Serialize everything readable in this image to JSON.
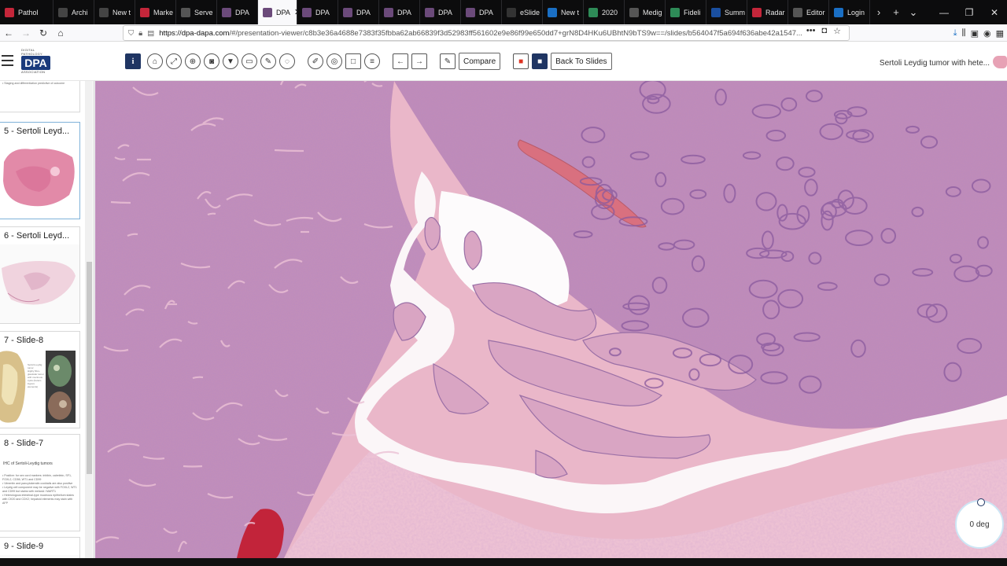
{
  "browser": {
    "tabs": [
      {
        "label": "Pathol",
        "icon": "pathology-icon",
        "color": "#c4263a"
      },
      {
        "label": "Archi",
        "icon": "archive-icon",
        "color": "#444"
      },
      {
        "label": "New t",
        "icon": "new-tab-icon",
        "color": "#444"
      },
      {
        "label": "Marke",
        "icon": "google-icon",
        "color": "#c4263a"
      },
      {
        "label": "Serve",
        "icon": "gear-icon",
        "color": "#555"
      },
      {
        "label": "DPA",
        "icon": "dpa-icon",
        "color": "#6b4a7a"
      },
      {
        "label": "DPA",
        "icon": "dpa-icon",
        "color": "#6b4a7a",
        "active": true
      },
      {
        "label": "DPA",
        "icon": "dpa-icon",
        "color": "#6b4a7a"
      },
      {
        "label": "DPA",
        "icon": "dpa-icon",
        "color": "#6b4a7a"
      },
      {
        "label": "DPA",
        "icon": "dpa-icon",
        "color": "#6b4a7a"
      },
      {
        "label": "DPA",
        "icon": "dpa-icon",
        "color": "#6b4a7a"
      },
      {
        "label": "DPA",
        "icon": "dpa-icon",
        "color": "#6b4a7a"
      },
      {
        "label": "eSlide",
        "icon": "eslide-icon",
        "color": "#333"
      },
      {
        "label": "New t",
        "icon": "search-icon",
        "color": "#1a6fc4"
      },
      {
        "label": "2020",
        "icon": "sheet-icon",
        "color": "#2e8b57"
      },
      {
        "label": "Medig",
        "icon": "medig-icon",
        "color": "#555"
      },
      {
        "label": "Fideli",
        "icon": "fidelity-icon",
        "color": "#2e8b57"
      },
      {
        "label": "Summ",
        "icon": "p-icon",
        "color": "#1a4fa0"
      },
      {
        "label": "Radar",
        "icon": "google-icon",
        "color": "#c4263a"
      },
      {
        "label": "Editor",
        "icon": "editor-icon",
        "color": "#555"
      },
      {
        "label": "Login",
        "icon": "login-icon",
        "color": "#1a6fc4"
      }
    ],
    "url_domain": "https://dpa-dapa.com",
    "url_path": "/#/presentation-viewer/c8b3e36a4688e7383f35fbba62ab66839f3d52983ff561602e9e86f99e650dd7+grN8D4HKu6UBhtN9bTS9w==/slides/b564047f5a694f636abe42a1547..."
  },
  "app": {
    "logo_top": "DIGITAL PATHOLOGY",
    "logo_main": "DPA",
    "logo_bottom": "ASSOCIATION",
    "compare_label": "Compare",
    "back_label": "Back To Slides",
    "slide_title": "Sertoli Leydig tumor with hete..."
  },
  "sidebar": {
    "top_snippet": "• Staging and differentiation predictive of outcome",
    "slides": [
      {
        "label": "5 - Sertoli Leyd..."
      },
      {
        "label": "6 - Sertoli Leyd..."
      },
      {
        "label": "7 - Slide-8"
      },
      {
        "label": "8 - Slide-7"
      },
      {
        "label": "9 - Slide-9"
      }
    ],
    "slide8_title": "IHC of Sertoli-Leydig tumors",
    "slide8_lines": [
      "• Positive: for sex cord markers: inhibin, calretinin, SF1, FOXL2, CD56, WT1 and CD99",
      "• Vimentin and pancytokeratin cocktails are also positive",
      "• Leydig cell component may be negative with FOXL2, WT1 and CD99 but stains with melanA / MART1",
      "• Heterologous intestinal-type mucinous epithelium stains with CK20 and CDX2; hepatoid elements may stain with AFP"
    ],
    "slide7_text": [
      "Sertoli-Leydig",
      "tumor",
      "Highly fibro-",
      "glandular tumor",
      "with mucinous",
      "cysts (hetero-",
      "logous",
      "elements)"
    ]
  },
  "viewer": {
    "rotation": "0 deg"
  },
  "colors": {
    "brand_navy": "#1f3563",
    "tissue_pink": "#e8b6c9",
    "nuclei_purple": "#7a4e93"
  }
}
